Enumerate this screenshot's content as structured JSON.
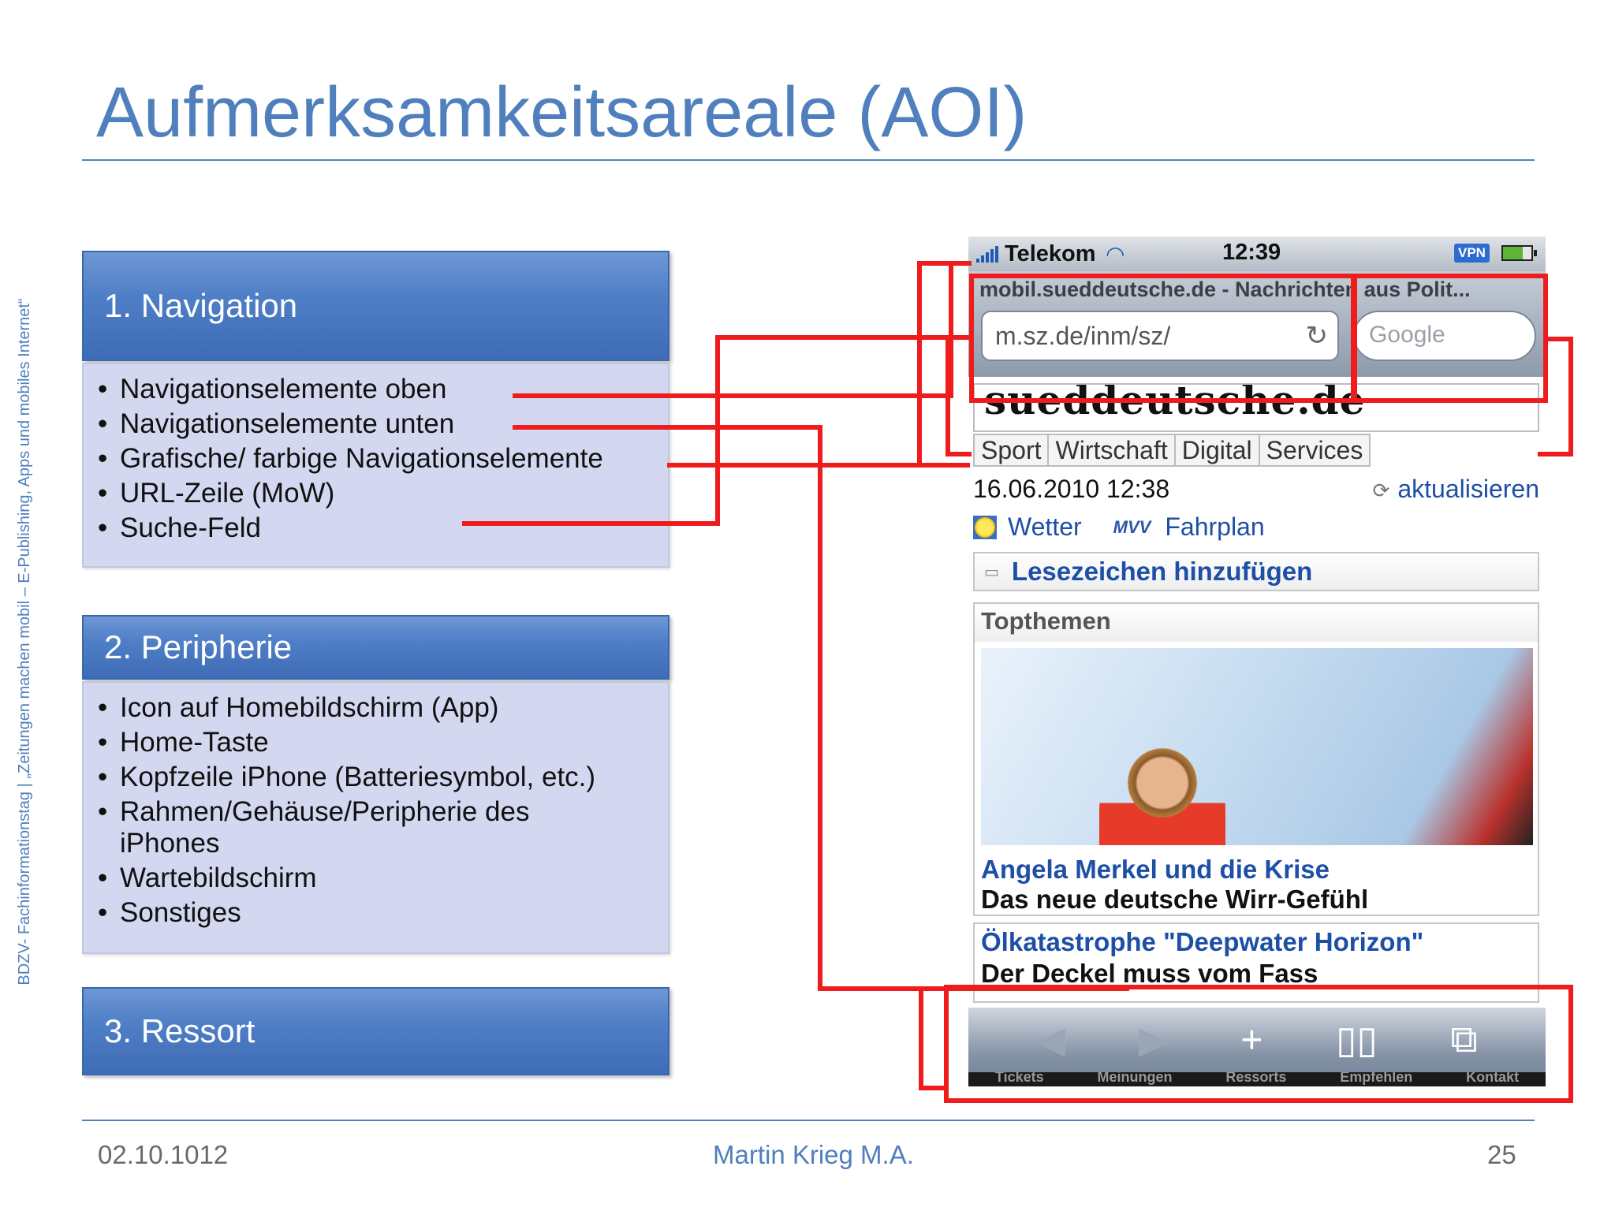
{
  "slide": {
    "title": "Aufmerksamkeitsareale (AOI)",
    "side_text": "BDZV- Fachinformationstag   |   „Zeitungen machen mobil – E-Publishing, Apps und mobiles Internet“"
  },
  "sections": [
    {
      "title": "1. Navigation",
      "items": [
        "Navigationselemente oben",
        "Navigationselemente unten",
        "Grafische/ farbige Navigationselemente",
        "URL-Zeile (MoW)",
        "Suche-Feld"
      ]
    },
    {
      "title": "2. Peripherie",
      "items": [
        "Icon auf Homebildschirm (App)",
        "Home-Taste",
        "Kopfzeile iPhone (Batteriesymbol, etc.)",
        "Rahmen/Gehäuse/Peripherie des iPhones",
        "Wartebildschirm",
        "Sonstiges"
      ]
    },
    {
      "title": "3. Ressort"
    }
  ],
  "phone": {
    "carrier": "Telekom",
    "time": "12:39",
    "vpn": "VPN",
    "page_title": "mobil.sueddeutsche.de - Nachrichten aus Polit...",
    "url": "m.sz.de/inm/sz/",
    "search_placeholder": "Google",
    "logo": "sueddeutsche.de",
    "menu": [
      "Sport",
      "Wirtschaft",
      "Digital",
      "Services"
    ],
    "date": "16.06.2010 12:38",
    "refresh_label": "aktualisieren",
    "weather_link": "Wetter",
    "mvv_label": "MVV",
    "timetable_link": "Fahrplan",
    "bookmark": "Lesezeichen hinzufügen",
    "topics_header": "Topthemen",
    "topic1_headline": "Angela Merkel und die Krise",
    "topic1_sub": "Das neue deutsche Wirr-Gefühl",
    "topic2_headline": "Ölkatastrophe \"Deepwater Horizon\"",
    "topic2_sub": "Der Deckel muss vom Fass",
    "tabbar": [
      "Tickets",
      "Meinungen",
      "Ressorts",
      "Empfehlen",
      "Kontakt"
    ]
  },
  "footer": {
    "date": "02.10.1012",
    "author": "Martin Krieg  M.A.",
    "page": "25"
  },
  "colors": {
    "accent": "#4f81bd",
    "annotation": "#ee1c1c",
    "section_header": "#4f7fc7",
    "section_body": "#d3d8f0",
    "link": "#1d4fa6"
  },
  "icons": [
    "signal-icon",
    "wifi-icon",
    "battery-icon",
    "reload-icon",
    "refresh-icon",
    "sun-icon",
    "book-icon",
    "back-icon",
    "forward-icon",
    "plus-icon",
    "bookmarks-icon",
    "pages-icon"
  ]
}
